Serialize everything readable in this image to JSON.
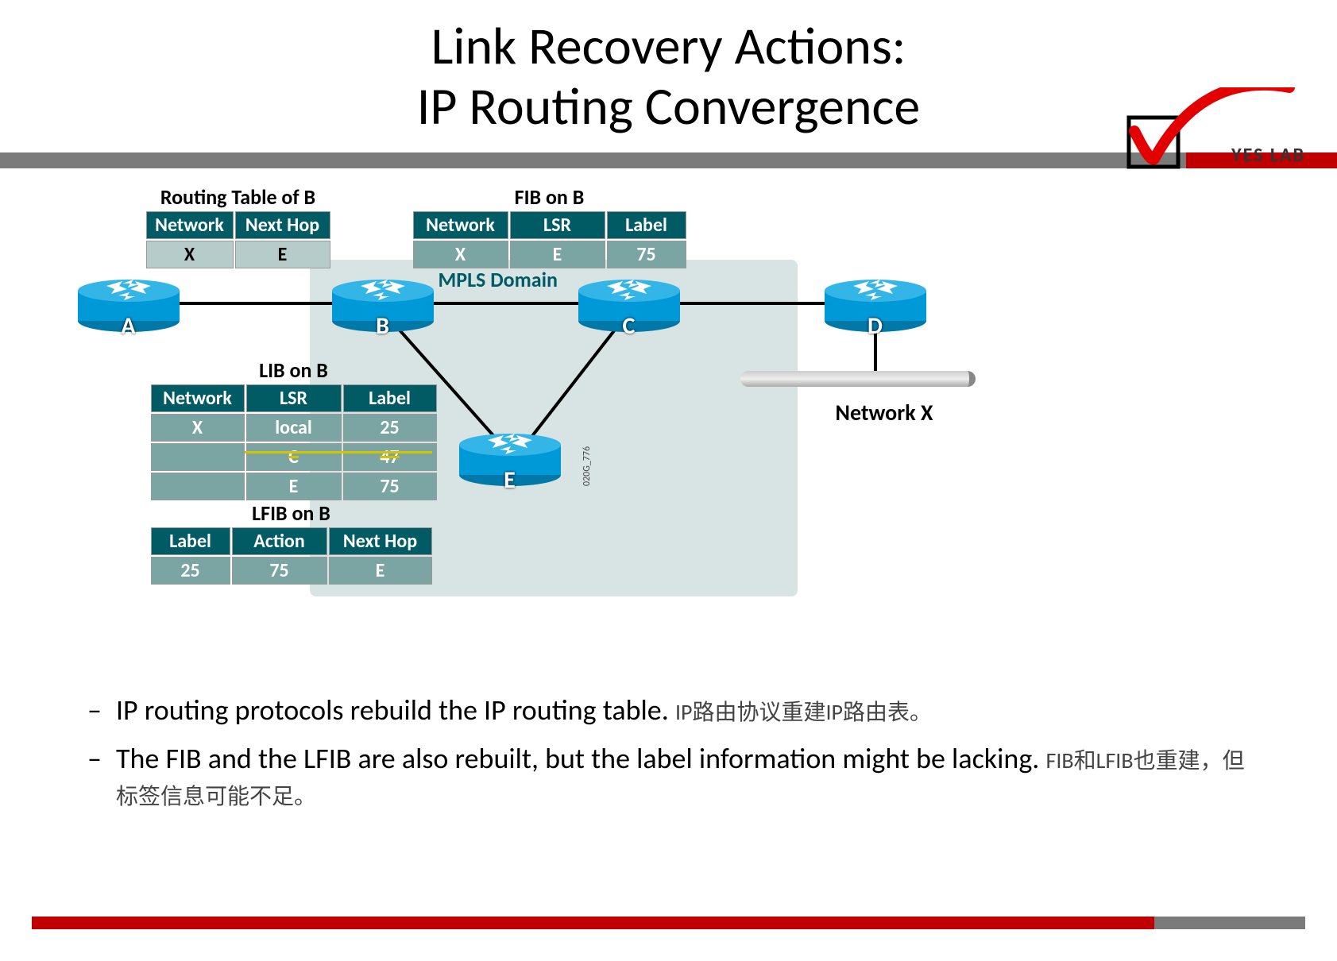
{
  "title_line1": "Link Recovery Actions:",
  "title_line2": "IP Routing Convergence",
  "logo_text": "YES LAB",
  "diagram": {
    "mpls_domain_label": "MPLS Domain",
    "network_x_label": "Network X",
    "image_ref": "020G_776",
    "routers": {
      "A": "A",
      "B": "B",
      "C": "C",
      "D": "D",
      "E": "E"
    },
    "routing_table_b": {
      "title": "Routing Table of B",
      "headers": [
        "Network",
        "Next Hop"
      ],
      "rows": [
        [
          "X",
          "E"
        ]
      ]
    },
    "fib_on_b": {
      "title": "FIB on B",
      "headers": [
        "Network",
        "LSR",
        "Label"
      ],
      "rows": [
        [
          "X",
          "E",
          "75"
        ]
      ]
    },
    "lib_on_b": {
      "title": "LIB on B",
      "headers": [
        "Network",
        "LSR",
        "Label"
      ],
      "rows": [
        [
          "X",
          "local",
          "25"
        ],
        [
          "",
          "C",
          "47"
        ],
        [
          "",
          "E",
          "75"
        ]
      ],
      "strikethrough_row_index": 1
    },
    "lfib_on_b": {
      "title": "LFIB on B",
      "headers": [
        "Label",
        "Action",
        "Next Hop"
      ],
      "rows": [
        [
          "25",
          "75",
          "E"
        ]
      ]
    }
  },
  "bullets": [
    {
      "en": "IP routing protocols rebuild the IP routing table.",
      "zh": "IP路由协议重建IP路由表。"
    },
    {
      "en": "The FIB and the LFIB are also rebuilt, but the label  information might be lacking.",
      "zh": "FIB和LFIB也重建，但标签信息可能不足。"
    }
  ]
}
